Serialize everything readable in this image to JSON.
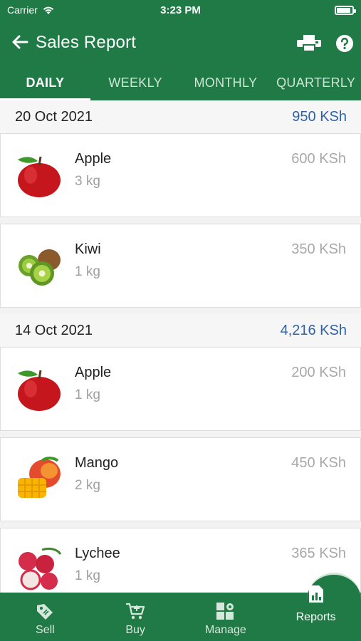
{
  "status": {
    "carrier": "Carrier",
    "time": "3:23 PM"
  },
  "appbar": {
    "title": "Sales Report"
  },
  "tabs": [
    {
      "label": "DAILY",
      "active": true
    },
    {
      "label": "WEEKLY",
      "active": false
    },
    {
      "label": "MONTHLY",
      "active": false
    },
    {
      "label": "QUARTERLY",
      "active": false
    }
  ],
  "groups": [
    {
      "date": "20 Oct 2021",
      "total": "950 KSh",
      "items": [
        {
          "name": "Apple",
          "qty": "3 kg",
          "price": "600 KSh",
          "icon": "apple"
        },
        {
          "name": "Kiwi",
          "qty": "1 kg",
          "price": "350 KSh",
          "icon": "kiwi"
        }
      ]
    },
    {
      "date": "14 Oct 2021",
      "total": "4,216 KSh",
      "items": [
        {
          "name": "Apple",
          "qty": "1 kg",
          "price": "200 KSh",
          "icon": "apple"
        },
        {
          "name": "Mango",
          "qty": "2 kg",
          "price": "450 KSh",
          "icon": "mango"
        },
        {
          "name": "Lychee",
          "qty": "1 kg",
          "price": "365 KSh",
          "icon": "lychee"
        }
      ]
    }
  ],
  "nav": [
    {
      "label": "Sell",
      "icon": "sell-tag",
      "active": false
    },
    {
      "label": "Buy",
      "icon": "cart",
      "active": false
    },
    {
      "label": "Manage",
      "icon": "grid-gear",
      "active": false
    },
    {
      "label": "Reports",
      "icon": "chart-doc",
      "active": true
    }
  ],
  "colors": {
    "primary": "#1f7a45",
    "total": "#2f62a8"
  }
}
